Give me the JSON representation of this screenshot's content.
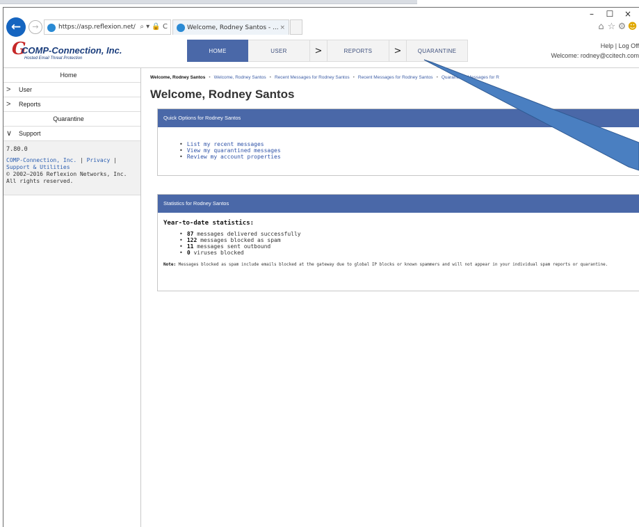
{
  "browser": {
    "address_url": "https://asp.reflexion.net/",
    "address_tools": "⌕ ▾ 🔒 C",
    "tab_title": "Welcome, Rodney Santos - ...",
    "tab_close": "×",
    "window_controls": {
      "minimize": "–",
      "maximize": "☐",
      "close": "×"
    },
    "toolbar_icons": [
      "home-icon",
      "star-icon",
      "gear-icon",
      "smiley-icon"
    ]
  },
  "site": {
    "logo_name": "COMP-Connection, Inc.",
    "logo_tagline": "Hosted Email Threat Protection",
    "nav": [
      {
        "label": "HOME"
      },
      {
        "label": "USER"
      },
      {
        "label": "REPORTS"
      },
      {
        "label": "QUARANTINE"
      }
    ],
    "nav_separator": ">",
    "help": "Help",
    "logoff": "Log Off",
    "welcome_prefix": "Welcome: ",
    "user_email": "rodney@ccitech.com"
  },
  "sidebar": {
    "items": [
      {
        "label": "Home"
      },
      {
        "label": "User",
        "chevron": ">"
      },
      {
        "label": "Reports",
        "chevron": ">"
      },
      {
        "label": "Quarantine"
      },
      {
        "label": "Support",
        "chevron": "∨"
      }
    ],
    "version": "7.80.0",
    "company_link": "COMP-Connection, Inc.",
    "privacy_link": "Privacy",
    "support_link": "Support & Utilities",
    "copyright": "© 2002—2016 Reflexion Networks, Inc.",
    "rights": "All rights reserved."
  },
  "main": {
    "breadcrumbs": [
      "Welcome, Rodney Santos",
      "Welcome, Rodney Santos",
      "Recent Messages for Rodney Santos",
      "Recent Messages for Rodney Santos",
      "Quarantined Messages for R"
    ],
    "title": "Welcome, Rodney Santos",
    "quick_options": {
      "heading": "Quick Options for Rodney Santos",
      "links": [
        "List my recent messages",
        "View my quarantined messages",
        "Review my account properties"
      ]
    },
    "statistics": {
      "heading": "Statistics for Rodney Santos",
      "subheading": "Year-to-date statistics:",
      "items": [
        {
          "count": "87",
          "text": " messages delivered successfully"
        },
        {
          "count": "122",
          "text": " messages blocked as spam"
        },
        {
          "count": "11",
          "text": " messages sent outbound"
        },
        {
          "count": "0",
          "text": " viruses blocked"
        }
      ],
      "note_label": "Note:",
      "note_text": " Messages blocked as spam include emails blocked at the gateway due to global IP blocks or known spammers and will not appear in your individual spam reports or quarantine."
    }
  },
  "annotation": {
    "arrow_color": "#4a7fc1",
    "arrow_stroke": "#2f5a93"
  },
  "colors": {
    "nav_active": "#4a68a8",
    "panel_header": "#4a68a8",
    "link": "#3054a8",
    "logo_red": "#c62828",
    "logo_blue": "#1a3d7c"
  }
}
